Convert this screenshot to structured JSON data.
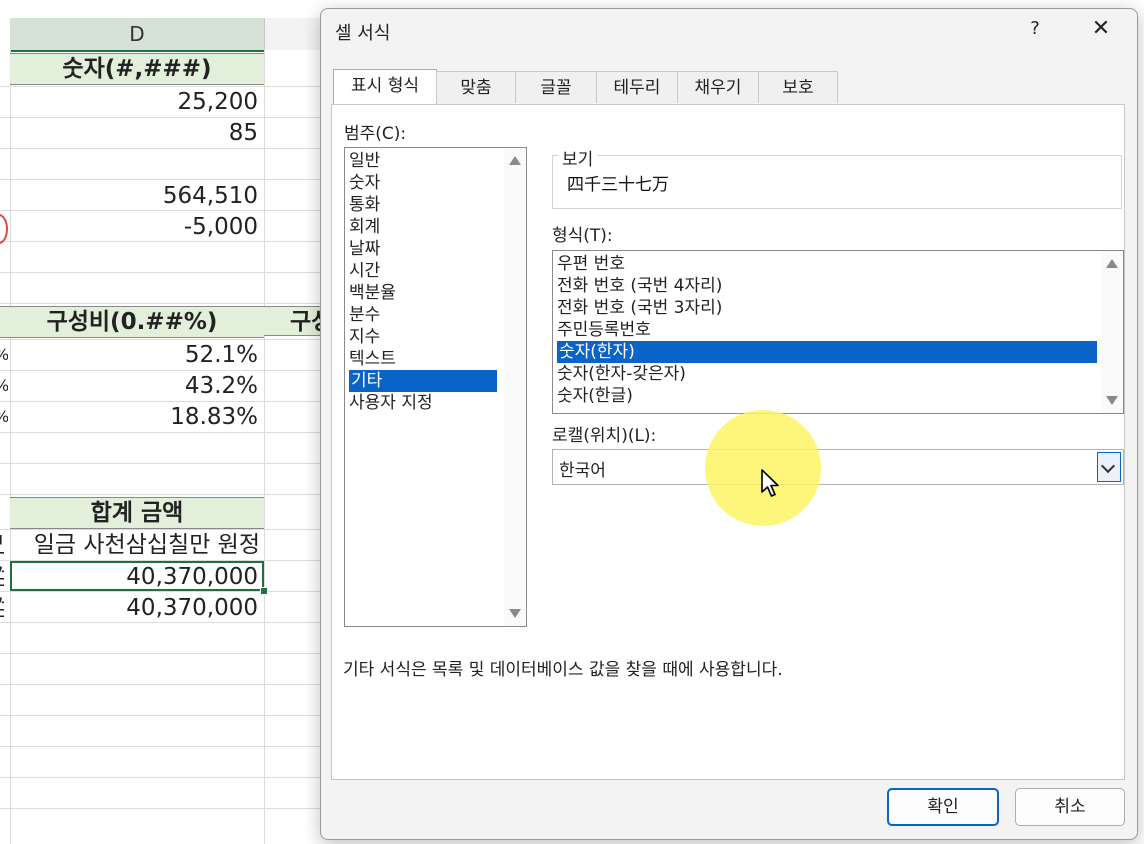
{
  "sheet": {
    "column_header": "D",
    "rows": [
      {
        "text": "숫자(#,###)",
        "kind": "header"
      },
      {
        "text": "25,200"
      },
      {
        "text": "85"
      },
      {
        "text": ""
      },
      {
        "text": "564,510"
      },
      {
        "text": "-5,000"
      },
      {
        "text": "구성비(0.##%)",
        "kind": "header"
      },
      {
        "text": "52.1%"
      },
      {
        "text": "43.2%"
      },
      {
        "text": "18.83%"
      },
      {
        "text": "합계 금액",
        "kind": "header"
      },
      {
        "text": "일금 사천삼십칠만 원정"
      },
      {
        "text": "40,370,000"
      },
      {
        "text": "40,370,000"
      }
    ],
    "next_column_partial": "구성",
    "left_edge_fragments": [
      "%",
      "%",
      "%",
      "만",
      "검",
      "검"
    ]
  },
  "dialog": {
    "title": "셀 서식",
    "help": "?",
    "close": "✕",
    "tabs": [
      "표시 형식",
      "맞춤",
      "글꼴",
      "테두리",
      "채우기",
      "보호"
    ],
    "active_tab": "표시 형식",
    "category_label": "범주(C):",
    "categories": [
      "일반",
      "숫자",
      "통화",
      "회계",
      "날짜",
      "시간",
      "백분율",
      "분수",
      "지수",
      "텍스트",
      "기타",
      "사용자 지정"
    ],
    "selected_category": "기타",
    "preview_label": "보기",
    "preview_value": "四千三十七万",
    "type_label": "형식(T):",
    "types": [
      "우편 번호",
      "전화 번호 (국번 4자리)",
      "전화 번호 (국번 3자리)",
      "주민등록번호",
      "숫자(한자)",
      "숫자(한자-갖은자)",
      "숫자(한글)"
    ],
    "selected_type": "숫자(한자)",
    "locale_label": "로캘(위치)(L):",
    "locale_value": "한국어",
    "description": "기타 서식은 목록 및 데이터베이스 값을 찾을 때에 사용합니다.",
    "ok": "확인",
    "cancel": "취소"
  },
  "colors": {
    "selection": "#0a64c8",
    "header_fill": "#e2efda",
    "excel_green": "#1e7145",
    "highlight": "#fdf564"
  }
}
